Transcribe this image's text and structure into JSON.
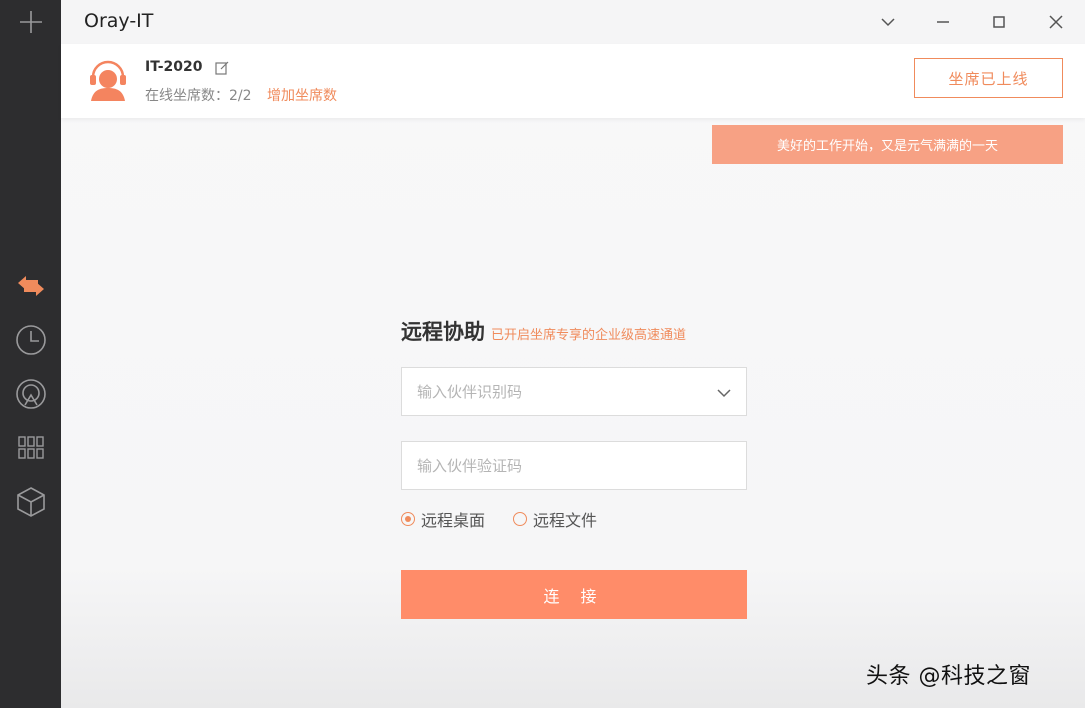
{
  "window": {
    "title": "Oray-IT"
  },
  "sidebar": {
    "items": [
      {
        "icon": "plus-icon"
      },
      {
        "icon": "swap-arrows-icon",
        "active": true
      },
      {
        "icon": "clock-icon"
      },
      {
        "icon": "broadcast-icon"
      },
      {
        "icon": "grid-icon"
      },
      {
        "icon": "cube-icon"
      }
    ]
  },
  "user": {
    "name": "IT-2020",
    "seat_info": "在线坐席数：2/2",
    "add_seats_label": "增加坐席数",
    "status_button": "坐席已上线"
  },
  "banner": {
    "text": "美好的工作开始，又是元气满满的一天"
  },
  "remote": {
    "title": "远程协助",
    "subtitle": "已开启坐席专享的企业级高速通道",
    "partner_id_placeholder": "输入伙伴识别码",
    "partner_code_placeholder": "输入伙伴验证码",
    "mode_desktop": "远程桌面",
    "mode_file": "远程文件",
    "selected_mode": "远程桌面",
    "connect_label": "连 接"
  },
  "watermark": {
    "text": "头条 @科技之窗"
  },
  "colors": {
    "accent": "#f08b5c",
    "button": "#ff8c69",
    "banner": "#f7a184",
    "sidebar": "#2d2d2f"
  }
}
